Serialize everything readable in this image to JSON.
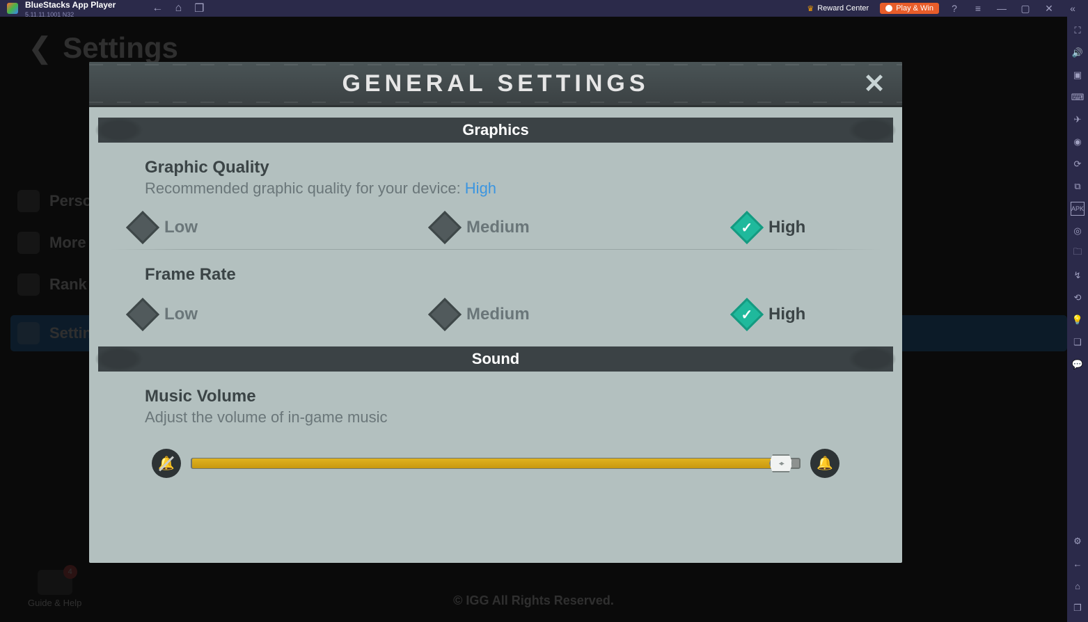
{
  "topbar": {
    "app_name": "BlueStacks App Player",
    "version": "5.11.11.1001 N32",
    "reward_center": "Reward Center",
    "play_win": "Play & Win"
  },
  "background": {
    "title": "Settings",
    "nav": {
      "personal": "Personal info",
      "more": "More Information",
      "rank": "Rank",
      "settings": "Settings"
    },
    "help_label": "Guide & Help",
    "help_badge": "4",
    "copyright": "© IGG All Rights Reserved."
  },
  "modal": {
    "title": "GENERAL SETTINGS",
    "sections": {
      "graphics": "Graphics",
      "sound": "Sound"
    },
    "graphic_quality": {
      "title": "Graphic Quality",
      "sub_prefix": "Recommended graphic quality for your device: ",
      "recommended": "High",
      "options": {
        "low": "Low",
        "medium": "Medium",
        "high": "High"
      },
      "selected": "high"
    },
    "frame_rate": {
      "title": "Frame Rate",
      "options": {
        "low": "Low",
        "medium": "Medium",
        "high": "High"
      },
      "selected": "high"
    },
    "music_volume": {
      "title": "Music Volume",
      "sub": "Adjust the volume of in-game music",
      "value_pct": 97
    }
  }
}
